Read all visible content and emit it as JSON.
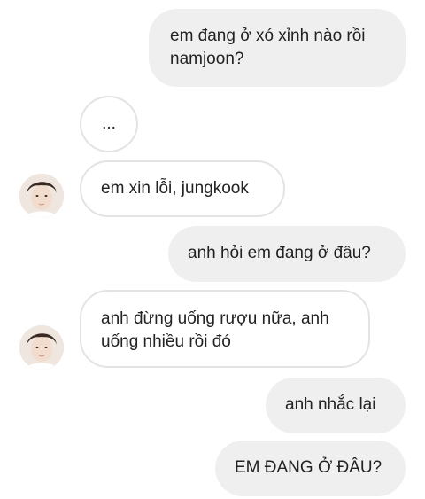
{
  "messages": [
    {
      "id": "m1",
      "direction": "outgoing",
      "text": "em đang ở xó xỉnh nào rồi namjoon?"
    },
    {
      "id": "m2",
      "direction": "incoming",
      "text": "..."
    },
    {
      "id": "m3",
      "direction": "incoming",
      "text": "em xin lỗi, jungkook",
      "avatar": "contact-avatar"
    },
    {
      "id": "m4",
      "direction": "outgoing",
      "text": "anh hỏi em đang ở đâu?"
    },
    {
      "id": "m5",
      "direction": "incoming",
      "text": "anh đừng uống rượu nữa, anh uống nhiều rồi đó",
      "avatar": "contact-avatar"
    },
    {
      "id": "m6",
      "direction": "outgoing",
      "text": "anh nhắc lại"
    },
    {
      "id": "m7",
      "direction": "outgoing",
      "text": "EM ĐANG Ở ĐÂU?"
    }
  ],
  "colors": {
    "outgoing_bubble": "#efefef",
    "incoming_bubble": "#ffffff",
    "incoming_border": "#e3e3e3",
    "text": "#222222"
  }
}
